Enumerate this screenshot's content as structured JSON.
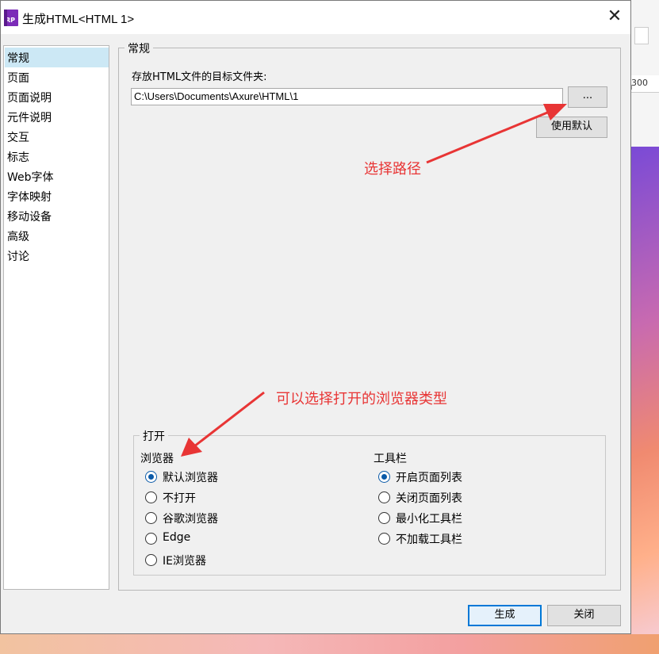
{
  "window": {
    "title": "生成HTML<HTML 1>",
    "icon_text": "RP",
    "close_glyph": "✕"
  },
  "background": {
    "ruler_value": "300"
  },
  "sidebar": {
    "items": [
      {
        "label": "常规",
        "selected": true
      },
      {
        "label": "页面",
        "selected": false
      },
      {
        "label": "页面说明",
        "selected": false
      },
      {
        "label": "元件说明",
        "selected": false
      },
      {
        "label": "交互",
        "selected": false
      },
      {
        "label": "标志",
        "selected": false
      },
      {
        "label": "Web字体",
        "selected": false
      },
      {
        "label": "字体映射",
        "selected": false
      },
      {
        "label": "移动设备",
        "selected": false
      },
      {
        "label": "高级",
        "selected": false
      },
      {
        "label": "讨论",
        "selected": false
      }
    ]
  },
  "general": {
    "legend": "常规",
    "folder_label": "存放HTML文件的目标文件夹:",
    "folder_value": "C:\\Users\\Documents\\Axure\\HTML\\1",
    "browse_label": "...",
    "use_default_label": "使用默认"
  },
  "open_group": {
    "legend": "打开",
    "browser_title": "浏览器",
    "browser_options": [
      {
        "label": "默认浏览器",
        "checked": true
      },
      {
        "label": "不打开",
        "checked": false
      },
      {
        "label": "谷歌浏览器",
        "checked": false
      },
      {
        "label": "Edge",
        "checked": false
      },
      {
        "label": "IE浏览器",
        "checked": false
      }
    ],
    "toolbar_title": "工具栏",
    "toolbar_options": [
      {
        "label": "开启页面列表",
        "checked": true
      },
      {
        "label": "关闭页面列表",
        "checked": false
      },
      {
        "label": "最小化工具栏",
        "checked": false
      },
      {
        "label": "不加载工具栏",
        "checked": false
      }
    ]
  },
  "annotations": {
    "select_path": "选择路径",
    "browser_type": "可以选择打开的浏览器类型",
    "color": "#e83535"
  },
  "footer": {
    "generate_label": "生成",
    "close_label": "关闭"
  },
  "colors": {
    "selected_item": "#cce8f5",
    "primary_border": "#0078d7",
    "radio_checked": "#0a5aa8"
  }
}
